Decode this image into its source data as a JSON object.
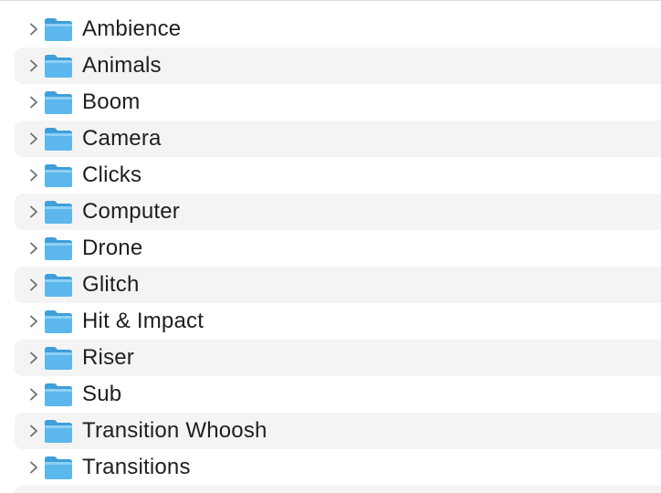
{
  "folders": [
    {
      "label": "Ambience",
      "icon": "folder-icon",
      "expander": "chevron-right-icon"
    },
    {
      "label": "Animals",
      "icon": "folder-icon",
      "expander": "chevron-right-icon"
    },
    {
      "label": "Boom",
      "icon": "folder-icon",
      "expander": "chevron-right-icon"
    },
    {
      "label": "Camera",
      "icon": "folder-icon",
      "expander": "chevron-right-icon"
    },
    {
      "label": "Clicks",
      "icon": "folder-icon",
      "expander": "chevron-right-icon"
    },
    {
      "label": "Computer",
      "icon": "folder-icon",
      "expander": "chevron-right-icon"
    },
    {
      "label": "Drone",
      "icon": "folder-icon",
      "expander": "chevron-right-icon"
    },
    {
      "label": "Glitch",
      "icon": "folder-icon",
      "expander": "chevron-right-icon"
    },
    {
      "label": "Hit & Impact",
      "icon": "folder-icon",
      "expander": "chevron-right-icon"
    },
    {
      "label": "Riser",
      "icon": "folder-icon",
      "expander": "chevron-right-icon"
    },
    {
      "label": "Sub",
      "icon": "folder-icon",
      "expander": "chevron-right-icon"
    },
    {
      "label": "Transition Whoosh",
      "icon": "folder-icon",
      "expander": "chevron-right-icon"
    },
    {
      "label": "Transitions",
      "icon": "folder-icon",
      "expander": "chevron-right-icon"
    }
  ],
  "colors": {
    "row_alt_background": "#f4f4f4",
    "folder_body": "#5cb8ec",
    "folder_tab": "#3e9fd9",
    "folder_highlight": "#8fd0f5",
    "text": "#1f1f1f",
    "chevron": "#6e6e6e"
  }
}
